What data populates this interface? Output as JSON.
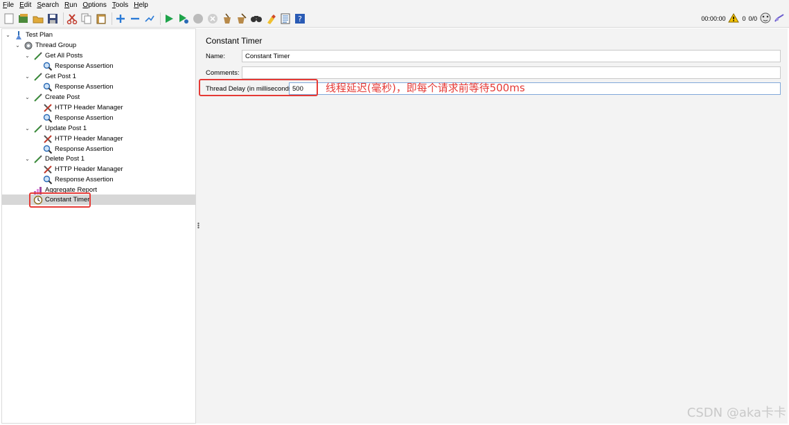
{
  "menu": [
    {
      "label": "File",
      "u": "F",
      "rest": "ile"
    },
    {
      "label": "Edit",
      "u": "E",
      "rest": "dit"
    },
    {
      "label": "Search",
      "u": "S",
      "rest": "earch"
    },
    {
      "label": "Run",
      "u": "R",
      "rest": "un"
    },
    {
      "label": "Options",
      "u": "O",
      "rest": "ptions"
    },
    {
      "label": "Tools",
      "u": "T",
      "rest": "ools"
    },
    {
      "label": "Help",
      "u": "H",
      "rest": "elp"
    }
  ],
  "status": {
    "elapsed": "00:00:00",
    "warnings": "0",
    "threads": "0/0"
  },
  "tree": {
    "nodes": [
      {
        "label": "Test Plan"
      },
      {
        "label": "Thread Group"
      },
      {
        "label": "Get All Posts"
      },
      {
        "label": "Response Assertion"
      },
      {
        "label": "Get Post 1"
      },
      {
        "label": "Response Assertion"
      },
      {
        "label": "Create Post"
      },
      {
        "label": "HTTP Header Manager"
      },
      {
        "label": "Response Assertion"
      },
      {
        "label": "Update Post 1"
      },
      {
        "label": "HTTP Header Manager"
      },
      {
        "label": "Response Assertion"
      },
      {
        "label": "Delete Post 1"
      },
      {
        "label": "HTTP Header Manager"
      },
      {
        "label": "Response Assertion"
      },
      {
        "label": "Aggregate Report"
      },
      {
        "label": "Constant Timer"
      }
    ]
  },
  "panel": {
    "title": "Constant Timer",
    "name_label": "Name:",
    "name_value": "Constant Timer",
    "comments_label": "Comments:",
    "comments_value": "",
    "delay_label": "Thread Delay (in milliseconds):",
    "delay_value": "500"
  },
  "annotation": "线程延迟(毫秒)，即每个请求前等待500ms",
  "watermark": "CSDN @aka卡卡",
  "colors": {
    "highlight": "#e53935",
    "selected_row": "#d7d7d7",
    "focus_border": "#7fa7d9"
  }
}
